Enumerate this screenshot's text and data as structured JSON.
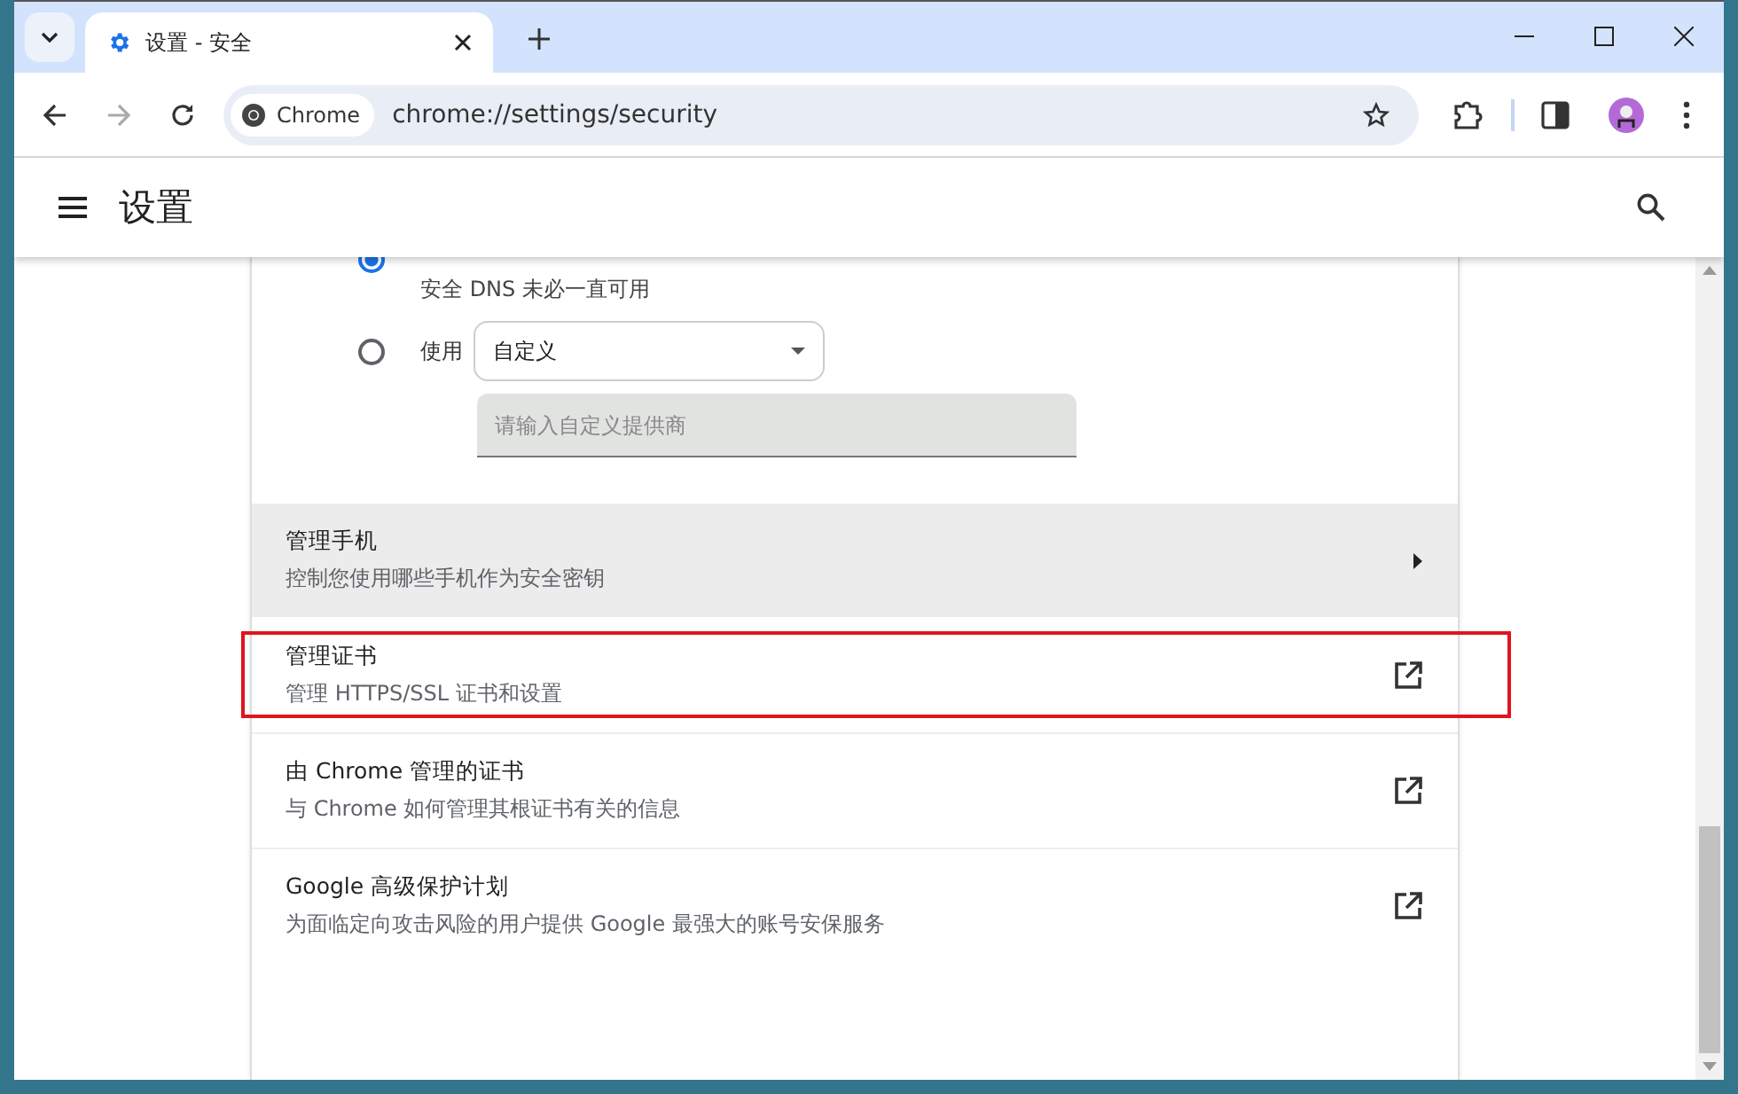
{
  "tab_strip": {
    "tabs": [
      {
        "title": "设置 - 安全",
        "selected": true
      }
    ]
  },
  "toolbar": {
    "site_chip": "Chrome",
    "url": "chrome://settings/security"
  },
  "header": {
    "title": "设置"
  },
  "dns": {
    "options": [
      {
        "kind": "preset",
        "description": "安全 DNS 未必一直可用",
        "selected": true
      },
      {
        "kind": "custom",
        "label": "使用",
        "dropdown_value": "自定义",
        "input_placeholder": "请输入自定义提供商",
        "selected": false
      }
    ]
  },
  "rows": [
    {
      "title": "管理手机",
      "subtitle": "控制您使用哪些手机作为安全密钥",
      "kind": "subpage",
      "hovered": true,
      "highlighted": false
    },
    {
      "title": "管理证书",
      "subtitle": "管理 HTTPS/SSL 证书和设置",
      "kind": "external",
      "hovered": false,
      "highlighted": true
    },
    {
      "title": "由 Chrome 管理的证书",
      "subtitle": "与 Chrome 如何管理其根证书有关的信息",
      "kind": "external",
      "hovered": false,
      "highlighted": false
    },
    {
      "title": "Google 高级保护计划",
      "subtitle": "为面临定向攻击风险的用户提供 Google 最强大的账号安保服务",
      "kind": "external",
      "hovered": false,
      "highlighted": false
    }
  ]
}
